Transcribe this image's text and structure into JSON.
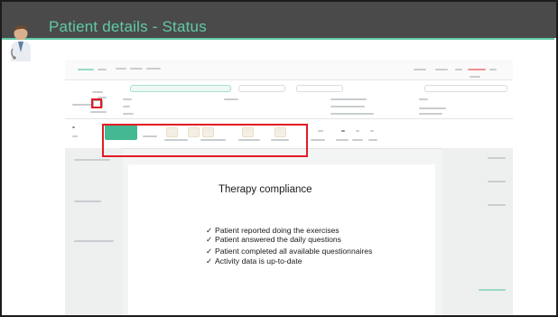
{
  "slide": {
    "title": "Patient details - Status",
    "accent": "#5fc9a8",
    "header_bg": "#4a4a4a",
    "callout_color": "#e31b23"
  },
  "card": {
    "title": "Therapy compliance",
    "items": [
      "Patient reported doing the exercises",
      "Patient answered the daily questions",
      "Patient completed all available questionnaires",
      "Activity data is up-to-date"
    ],
    "check_glyph": "✓"
  },
  "screenshot": {
    "active_step_color": "#43b892"
  }
}
